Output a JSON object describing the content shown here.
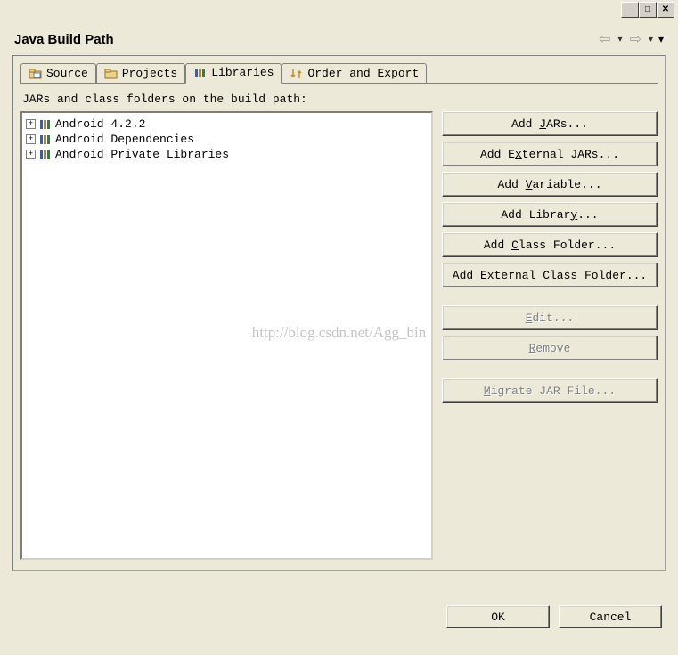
{
  "window_controls": {
    "min": "_",
    "max": "□",
    "close": "✕"
  },
  "header": {
    "title": "Java Build Path"
  },
  "tabs": [
    {
      "label": "Source"
    },
    {
      "label": "Projects"
    },
    {
      "label": "Libraries"
    },
    {
      "label": "Order and Export"
    }
  ],
  "active_tab": 2,
  "subtitle": "JARs and class folders on the build path:",
  "tree_items": [
    {
      "label": "Android 4.2.2"
    },
    {
      "label": "Android Dependencies"
    },
    {
      "label": "Android Private Libraries"
    }
  ],
  "buttons": {
    "add_jars_pre": "Add ",
    "add_jars_u": "J",
    "add_jars_post": "ARs...",
    "add_ext_jars_pre": "Add E",
    "add_ext_jars_u": "x",
    "add_ext_jars_post": "ternal JARs...",
    "add_var_pre": "Add ",
    "add_var_u": "V",
    "add_var_post": "ariable...",
    "add_lib_pre": "Add Librar",
    "add_lib_u": "y",
    "add_lib_post": "...",
    "add_class_pre": "Add ",
    "add_class_u": "C",
    "add_class_post": "lass Folder...",
    "add_ext_class": "Add External Class Folder...",
    "edit_u": "E",
    "edit_post": "dit...",
    "remove_u": "R",
    "remove_post": "emove",
    "migrate_u": "M",
    "migrate_post": "igrate JAR File..."
  },
  "footer": {
    "ok": "OK",
    "cancel": "Cancel"
  },
  "watermark": "http://blog.csdn.net/Agg_bin"
}
